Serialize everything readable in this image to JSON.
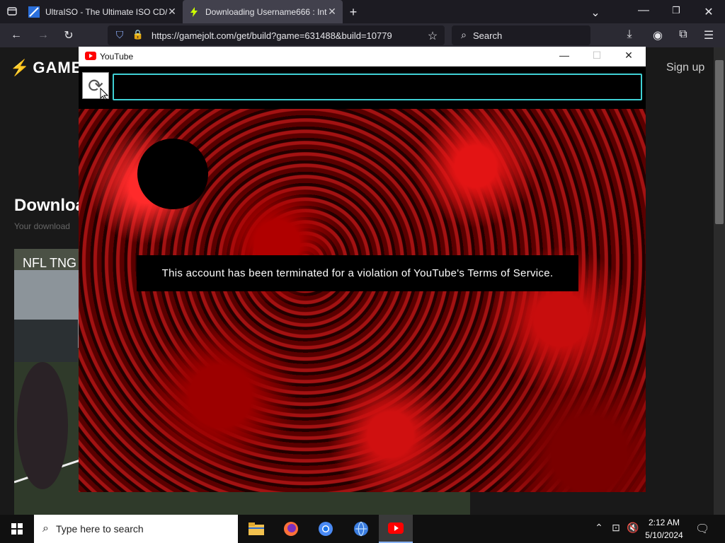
{
  "browser": {
    "tabs": [
      {
        "title": "UltraISO - The Ultimate ISO CD/"
      },
      {
        "title": "Downloading Username666 : Int"
      }
    ],
    "new_tab_label": "+",
    "url": "https://gamejolt.com/get/build?game=631488&build=10779",
    "search_placeholder": "Search"
  },
  "page": {
    "logo_text": "GAME",
    "signup_label": "Sign up",
    "download_heading": "Downloa",
    "download_subtext": "Your download",
    "card_title": "NFL TNG"
  },
  "popup": {
    "title": "YouTube",
    "minimize": "—",
    "maximize": "☐",
    "close": "✕",
    "refresh_icon": "⟳",
    "message": "This account has been terminated for a violation of YouTube's Terms of Service."
  },
  "taskbar": {
    "search_placeholder": "Type here to search",
    "time": "2:12 AM",
    "date": "5/10/2024"
  },
  "colors": {
    "progress_border": "#3fd0d4",
    "youtube_red": "#ff0000",
    "browser_bg": "#1c1b22"
  }
}
